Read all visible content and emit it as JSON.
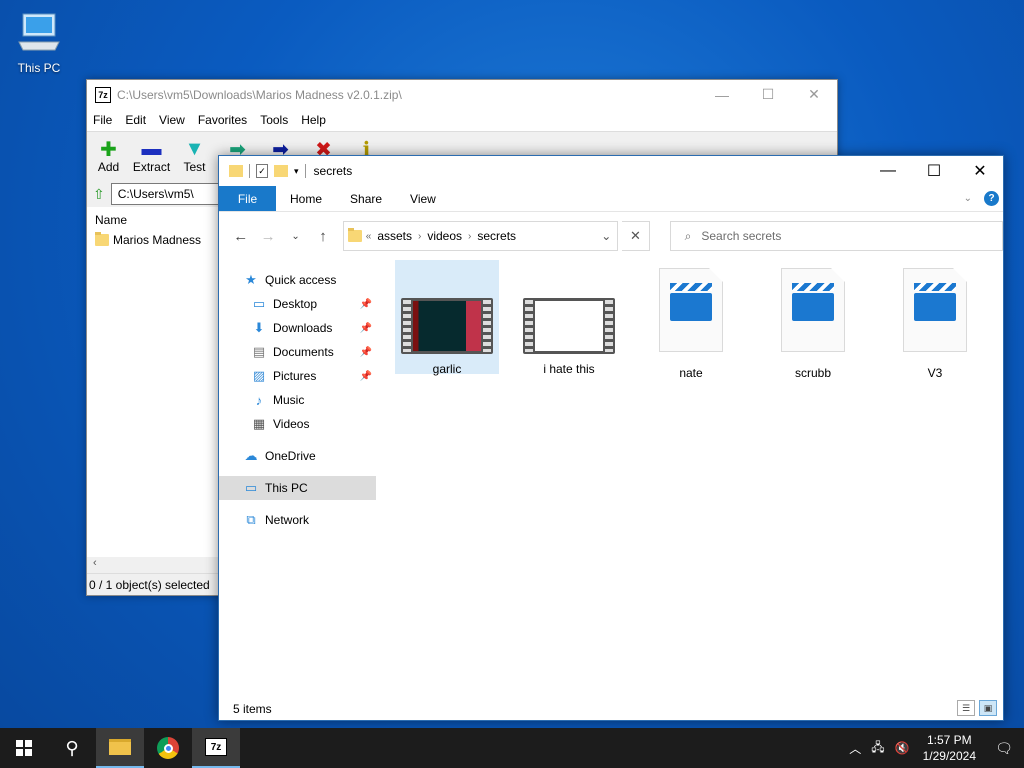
{
  "desktop": {
    "icon_label": "This PC"
  },
  "zip": {
    "title": "C:\\Users\\vm5\\Downloads\\Marios Madness v2.0.1.zip\\",
    "menu": [
      "File",
      "Edit",
      "View",
      "Favorites",
      "Tools",
      "Help"
    ],
    "toolbar": [
      {
        "label": "Add",
        "icon": "plus-icon",
        "color": "#1aa31a"
      },
      {
        "label": "Extract",
        "icon": "minus-icon",
        "color": "#1c2fbf"
      },
      {
        "label": "Test",
        "icon": "check-icon",
        "color": "#19b3b3"
      },
      {
        "label": "",
        "icon": "copy-arrow-icon",
        "color": "#1aa37a"
      },
      {
        "label": "",
        "icon": "move-arrow-icon",
        "color": "#0d1f9e"
      },
      {
        "label": "",
        "icon": "delete-icon",
        "color": "#d01818"
      },
      {
        "label": "",
        "icon": "info-icon",
        "color": "#b39a00"
      }
    ],
    "address": "C:\\Users\\vm5\\",
    "column_name": "Name",
    "row": "Marios Madness",
    "status": "0 / 1 object(s) selected"
  },
  "explorer": {
    "title": "secrets",
    "tabs": [
      "File",
      "Home",
      "Share",
      "View"
    ],
    "breadcrumb": [
      "assets",
      "videos",
      "secrets"
    ],
    "search_placeholder": "Search secrets",
    "nav": [
      {
        "label": "Quick access",
        "icon": "star-icon",
        "pinned": false,
        "indent": 0
      },
      {
        "label": "Desktop",
        "icon": "desktop-icon",
        "pinned": true,
        "indent": 1
      },
      {
        "label": "Downloads",
        "icon": "download-icon",
        "pinned": true,
        "indent": 1
      },
      {
        "label": "Documents",
        "icon": "documents-icon",
        "pinned": true,
        "indent": 1
      },
      {
        "label": "Pictures",
        "icon": "pictures-icon",
        "pinned": true,
        "indent": 1
      },
      {
        "label": "Music",
        "icon": "music-icon",
        "pinned": false,
        "indent": 1
      },
      {
        "label": "Videos",
        "icon": "videos-icon",
        "pinned": false,
        "indent": 1
      },
      {
        "label": "OneDrive",
        "icon": "cloud-icon",
        "pinned": false,
        "indent": 0
      },
      {
        "label": "This PC",
        "icon": "computer-icon",
        "pinned": false,
        "indent": 0
      },
      {
        "label": "Network",
        "icon": "network-icon",
        "pinned": false,
        "indent": 0
      }
    ],
    "files": [
      {
        "name": "garlic",
        "kind": "video-thumb"
      },
      {
        "name": "i hate this",
        "kind": "video-blank"
      },
      {
        "name": "nate",
        "kind": "video-file"
      },
      {
        "name": "scrubb",
        "kind": "video-file"
      },
      {
        "name": "V3",
        "kind": "video-file"
      }
    ],
    "status": "5 items"
  },
  "taskbar": {
    "time": "1:57 PM",
    "date": "1/29/2024",
    "app_7z": "7z"
  }
}
